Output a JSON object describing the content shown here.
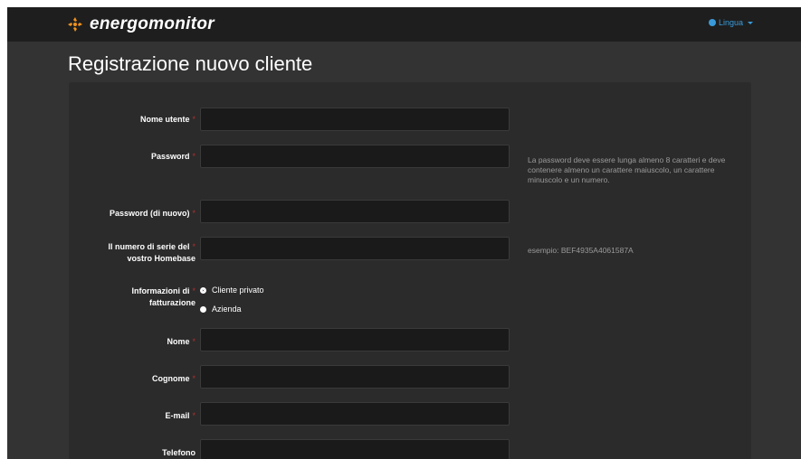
{
  "navbar": {
    "brand": "energomonitor",
    "language_label": "Lingua"
  },
  "page": {
    "title": "Registrazione nuovo cliente"
  },
  "form": {
    "required_marker": "*",
    "username_label": "Nome utente",
    "password_label": "Password",
    "password_help": "La password deve essere lunga almeno 8 caratteri e deve contenere almeno un carattere maiuscolo, un carattere minuscolo e un numero.",
    "password_repeat_label": "Password (di nuovo)",
    "serial_label_line1": "Il numero di serie del",
    "serial_label_line2": "vostro Homebase",
    "serial_help": "esempio: BEF4935A4061587A",
    "billing_label_line1": "Informazioni di",
    "billing_label_line2": "fatturazione",
    "billing_options": [
      "Cliente privato",
      "Azienda"
    ],
    "billing_selected": "Cliente privato",
    "first_name_label": "Nome",
    "last_name_label": "Cognome",
    "email_label": "E-mail",
    "phone_label": "Telefono",
    "values": {
      "username": "",
      "password": "",
      "password_repeat": "",
      "serial": "",
      "first_name": "",
      "last_name": "",
      "email": "",
      "phone": ""
    }
  },
  "colors": {
    "accent_orange": "#f0921e",
    "link_blue": "#3a9ad9",
    "required_red": "#b03030"
  },
  "icons": {
    "brand": "energomonitor-logo-icon",
    "language": "globe-icon",
    "dropdown": "caret-down-icon"
  }
}
